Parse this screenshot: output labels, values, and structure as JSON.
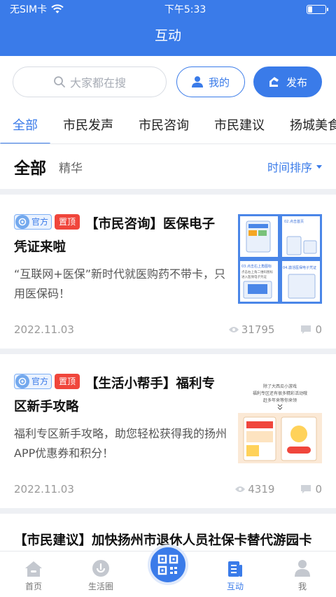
{
  "status": {
    "carrier": "无SIM卡",
    "time": "下午5:33"
  },
  "header": {
    "title": "互动"
  },
  "toolbar": {
    "search_placeholder": "大家都在搜",
    "mine_label": "我的",
    "post_label": "发布"
  },
  "tabs": [
    {
      "label": "全部",
      "active": true
    },
    {
      "label": "市民发声"
    },
    {
      "label": "市民咨询"
    },
    {
      "label": "市民建议"
    },
    {
      "label": "扬城美食"
    }
  ],
  "subbar": {
    "all_label": "全部",
    "best_label": "精华",
    "sort_label": "时间排序"
  },
  "posts": [
    {
      "official_label": "官方",
      "pinned_label": "置顶",
      "title": "【市民咨询】医保电子凭证来啦",
      "desc": "“互联网+医保”新时代就医购药不带卡，只用医保码！",
      "date": "2022.11.03",
      "views": "31795",
      "comments": "0",
      "thumb_texts": [
        "02.点击首页",
        "03.点击右上角图标",
        "点击右上角二维码图标",
        "进入医保电子凭证",
        "04.激活医保电子凭证"
      ]
    },
    {
      "official_label": "官方",
      "pinned_label": "置顶",
      "title": "【生活小帮手】福利专区新手攻略",
      "desc": "福利专区新手攻略，助您轻松获得我的扬州APP优惠券和积分！",
      "date": "2022.11.03",
      "views": "4319",
      "comments": "0",
      "thumb_texts": [
        "除了大西瓜小游戏",
        "福利专区还有很多精彩活动哦",
        "赶多年来等你来领"
      ]
    },
    {
      "title": "【市民建议】加快扬州市退休人员社保卡替代游园卡进程"
    }
  ],
  "bottom_nav": [
    {
      "label": "首页",
      "icon": "home-icon"
    },
    {
      "label": "生活圈",
      "icon": "life-circle-icon"
    },
    {
      "label": "",
      "icon": "qr-scan-icon"
    },
    {
      "label": "互动",
      "icon": "interaction-icon",
      "active": true
    },
    {
      "label": "我",
      "icon": "user-icon"
    }
  ],
  "colors": {
    "brand": "#3a7be9",
    "pinned": "#f0463c"
  }
}
